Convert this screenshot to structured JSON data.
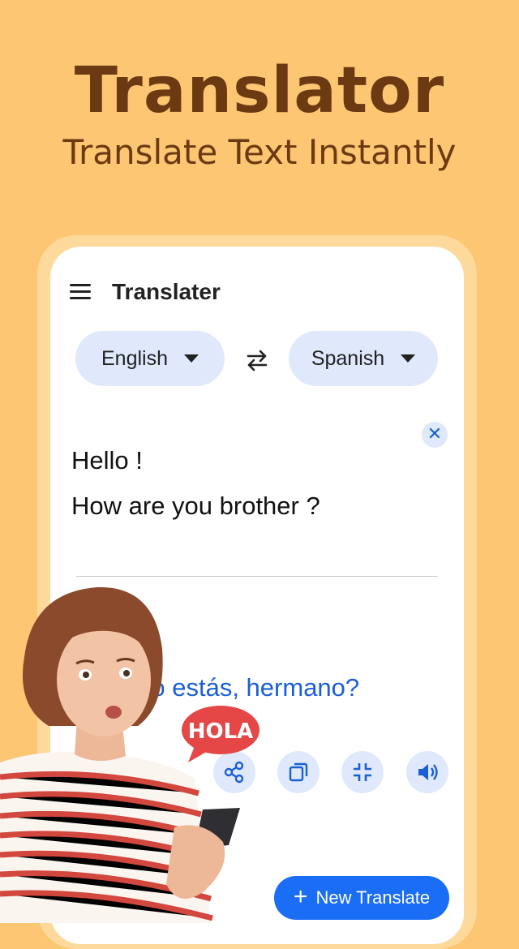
{
  "promo": {
    "title": "Translator",
    "subtitle": "Translate Text Instantly"
  },
  "app": {
    "title": "Translater",
    "source_language": "English",
    "target_language": "Spanish",
    "input_lines": [
      "Hello !",
      "How are you brother ?"
    ],
    "output_text": "¿Cómo estás, hermano?",
    "new_button_label": "New Translate"
  },
  "sticker": {
    "text": "HOLA"
  },
  "colors": {
    "background": "#FCC672",
    "headline": "#6B3A13",
    "accent": "#1A6DF5",
    "chip": "#DFE9FB",
    "output": "#1A5FD6"
  },
  "icons": [
    "menu-icon",
    "swap-icon",
    "close-icon",
    "share-icon",
    "copy-icon",
    "fullscreen-exit-icon",
    "speaker-icon",
    "plus-icon"
  ]
}
